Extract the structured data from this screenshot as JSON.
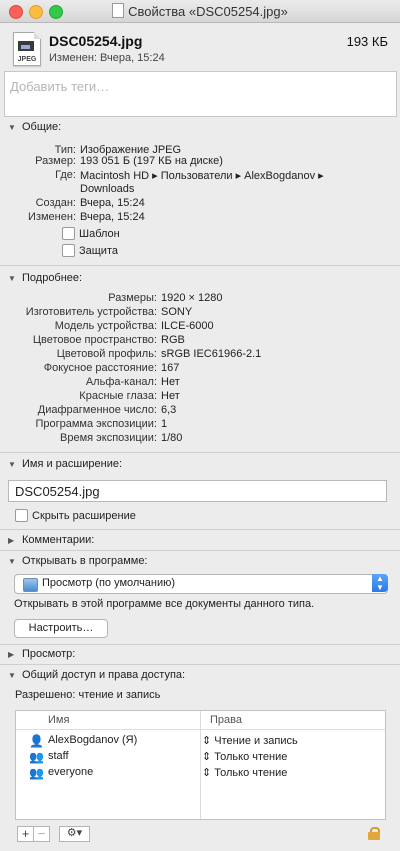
{
  "window": {
    "title": "Свойства «DSC05254.jpg»"
  },
  "header": {
    "icon_label": "JPEG",
    "file_name": "DSC05254.jpg",
    "modified": "Изменен: Вчера, 15:24",
    "size": "193 КБ"
  },
  "tags": {
    "placeholder": "Добавить теги…"
  },
  "general": {
    "title": "Общие:",
    "rows": [
      {
        "key": "Тип:",
        "value": "Изображение JPEG"
      },
      {
        "key": "Размер:",
        "value": "193 051 Б (197 КБ на диске)"
      },
      {
        "key": "Где:",
        "value": "Macintosh HD ▸ Пользователи ▸ AlexBogdanov ▸"
      },
      {
        "key": "",
        "value": "Downloads"
      },
      {
        "key": "Создан:",
        "value": "Вчера, 15:24"
      },
      {
        "key": "Изменен:",
        "value": "Вчера, 15:24"
      }
    ],
    "stationery_label": "Шаблон",
    "locked_label": "Защита"
  },
  "more_info": {
    "title": "Подробнее:",
    "rows": [
      {
        "key": "Размеры:",
        "value": "1920 × 1280"
      },
      {
        "key": "Изготовитель устройства:",
        "value": "SONY"
      },
      {
        "key": "Модель устройства:",
        "value": "ILCE-6000"
      },
      {
        "key": "Цветовое пространство:",
        "value": "RGB"
      },
      {
        "key": "Цветовой профиль:",
        "value": "sRGB IEC61966-2.1"
      },
      {
        "key": "Фокусное расстояние:",
        "value": "167"
      },
      {
        "key": "Альфа-канал:",
        "value": "Нет"
      },
      {
        "key": "Красные глаза:",
        "value": "Нет"
      },
      {
        "key": "Диафрагменное число:",
        "value": "6,3"
      },
      {
        "key": "Программа экспозиции:",
        "value": "1"
      },
      {
        "key": "Время экспозиции:",
        "value": "1/80"
      }
    ]
  },
  "name_ext": {
    "title": "Имя и расширение:",
    "value": "DSC05254.jpg",
    "hide_ext_label": "Скрыть расширение"
  },
  "comments": {
    "title": "Комментарии:"
  },
  "open_with": {
    "title": "Открывать в программе:",
    "selected": "Просмотр (по умолчанию)",
    "description": "Открывать в этой программе все документы данного типа.",
    "configure_label": "Настроить…"
  },
  "preview": {
    "title": "Просмотр:"
  },
  "sharing": {
    "title": "Общий доступ и права доступа:",
    "allowed": "Разрешено: чтение и запись",
    "col_name": "Имя",
    "col_perm": "Права",
    "entries": [
      {
        "name": "AlexBogdanov (Я)",
        "perm": "Чтение и запись"
      },
      {
        "name": "staff",
        "perm": "Только чтение"
      },
      {
        "name": "everyone",
        "perm": "Только чтение"
      }
    ],
    "add_glyph": "+",
    "remove_glyph": "−",
    "action_glyph": "⚙▾"
  },
  "colors": {
    "accent": "#2a79e8",
    "window_bg": "#ececec",
    "lock": "#e1a73b"
  }
}
